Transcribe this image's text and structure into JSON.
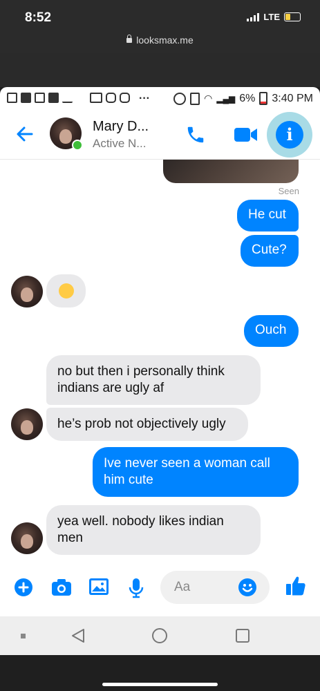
{
  "ios_status": {
    "time": "8:52",
    "network": "LTE"
  },
  "browser": {
    "url": "looksmax.me"
  },
  "android_status": {
    "battery": "6%",
    "time": "3:40 PM",
    "more": "···"
  },
  "header": {
    "name": "Mary D...",
    "status": "Active N..."
  },
  "chat": {
    "seen": "Seen",
    "messages": [
      {
        "dir": "out",
        "text": "He cut"
      },
      {
        "dir": "out",
        "text": "Cute?"
      },
      {
        "dir": "in",
        "text": "😂"
      },
      {
        "dir": "out",
        "text": "Ouch"
      },
      {
        "dir": "in",
        "text": "no but then i personally think indians are ugly af"
      },
      {
        "dir": "in",
        "text": "he’s prob not objectively ugly"
      },
      {
        "dir": "out",
        "text": "Ive never seen a woman call him cute"
      },
      {
        "dir": "in",
        "text": "yea well. nobody likes indian men"
      }
    ]
  },
  "composer": {
    "placeholder": "Aa"
  },
  "colors": {
    "accent": "#0084ff",
    "incoming_bubble": "#e9e9eb",
    "online": "#3fbe3a"
  }
}
